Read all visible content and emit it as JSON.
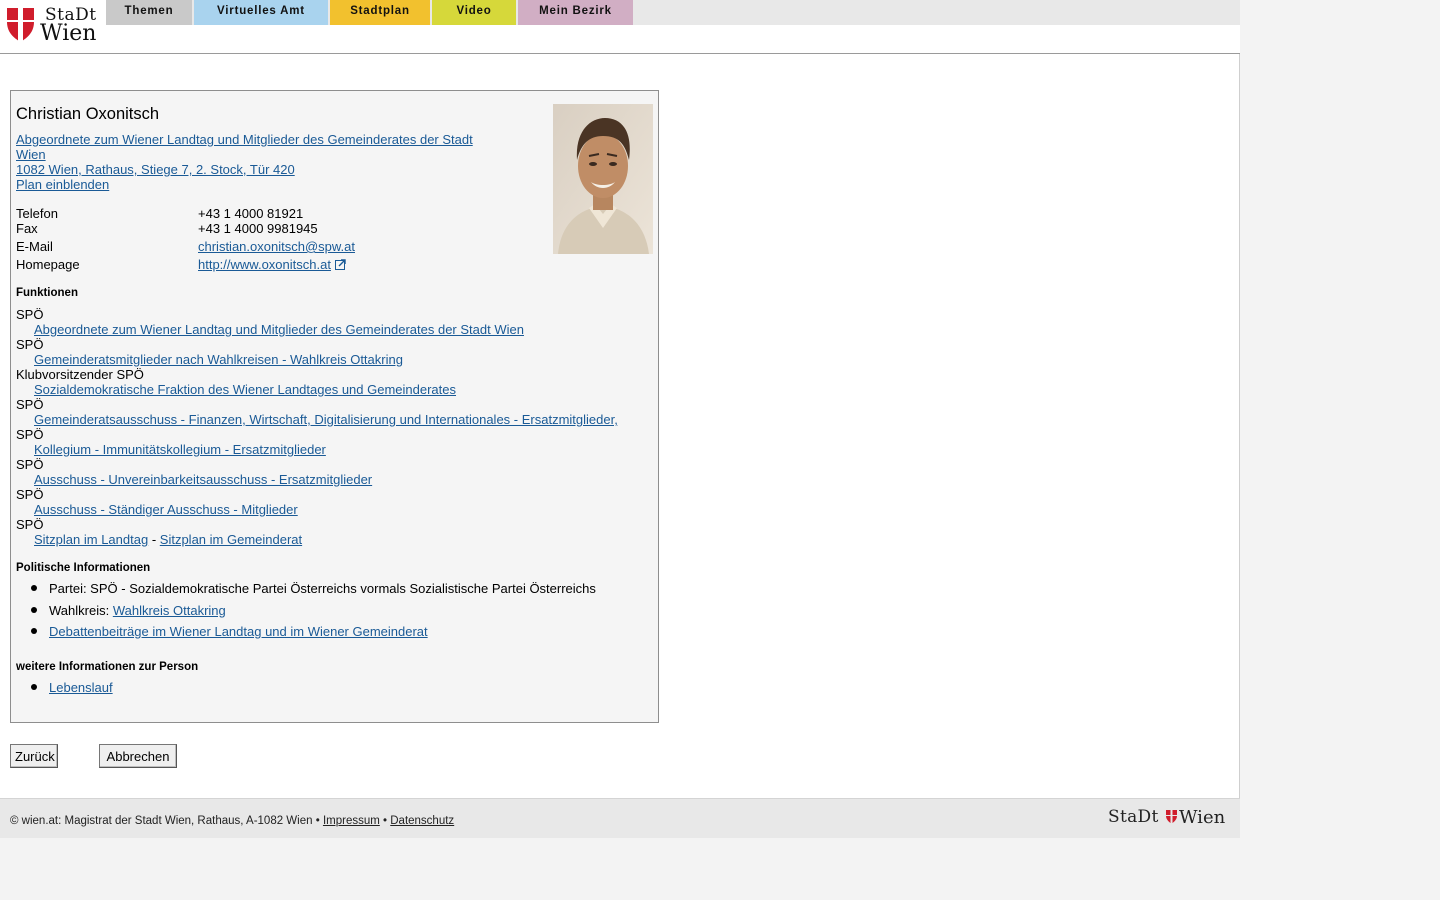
{
  "header": {
    "logo": {
      "word1": "StaDt",
      "word2": "Wien"
    },
    "nav": [
      {
        "label": "Themen",
        "color": "#c9c9c9"
      },
      {
        "label": "Virtuelles Amt",
        "color": "#a9d3ee"
      },
      {
        "label": "Stadtplan",
        "color": "#f2c12e"
      },
      {
        "label": "Video",
        "color": "#d6d83a"
      },
      {
        "label": "Mein Bezirk",
        "color": "#d1aec4"
      }
    ]
  },
  "person": {
    "name": "Christian Oxonitsch",
    "title_line1": "Abgeordnete zum Wiener Landtag und Mitglieder des Gemeinderates der Stadt",
    "title_line2": "Wien",
    "address": "1082 Wien, Rathaus, Stiege 7, 2. Stock, Tür 420",
    "plan_link": "Plan einblenden",
    "contact": {
      "phone_label": "Telefon",
      "phone": "+43 1 4000 81921",
      "fax_label": "Fax",
      "fax": "+43 1 4000 9981945",
      "email_label": "E-Mail",
      "email": "christian.oxonitsch@spw.at",
      "homepage_label": "Homepage",
      "homepage": "http://www.oxonitsch.at"
    }
  },
  "functions": {
    "heading": "Funktionen",
    "items": [
      {
        "role": "SPÖ",
        "link": "Abgeordnete zum Wiener Landtag und Mitglieder des Gemeinderates der Stadt Wien"
      },
      {
        "role": "SPÖ",
        "link": "Gemeinderatsmitglieder nach Wahlkreisen - Wahlkreis Ottakring"
      },
      {
        "role": "Klubvorsitzender SPÖ",
        "link": "Sozialdemokratische Fraktion des Wiener Landtages und Gemeinderates"
      },
      {
        "role": "SPÖ",
        "link": "Gemeinderatsausschuss - Finanzen, Wirtschaft, Digitalisierung und Internationales - Ersatzmitglieder, "
      },
      {
        "role": "SPÖ",
        "link": "Kollegium - Immunitätskollegium - Ersatzmitglieder"
      },
      {
        "role": "SPÖ",
        "link": "Ausschuss - Unvereinbarkeitsausschuss - Ersatzmitglieder"
      },
      {
        "role": "SPÖ",
        "link": "Ausschuss - Ständiger Ausschuss - Mitglieder"
      },
      {
        "role": "SPÖ",
        "link": "Sitzplan im Landtag",
        "separator": "-",
        "link2": "Sitzplan im Gemeinderat"
      }
    ]
  },
  "political": {
    "heading": "Politische Informationen",
    "party": "Partei: SPÖ - Sozialdemokratische Partei Österreichs vormals Sozialistische Partei Österreichs",
    "district_label": "Wahlkreis:",
    "district_link": "Wahlkreis Ottakring",
    "debates_link": "Debattenbeiträge im Wiener Landtag und im Wiener Gemeinderat"
  },
  "more": {
    "heading": "weitere Informationen zur Person",
    "cv_link": "Lebenslauf"
  },
  "buttons": {
    "back": "Zurück",
    "cancel": "Abbrechen"
  },
  "footer": {
    "copyright": "© wien.at: Magistrat der Stadt Wien, Rathaus, A-1082 Wien •",
    "impressum": "Impressum",
    "bullet": "•",
    "datenschutz": "Datenschutz",
    "logo": {
      "word1": "StaDt",
      "word2": "Wien"
    }
  }
}
